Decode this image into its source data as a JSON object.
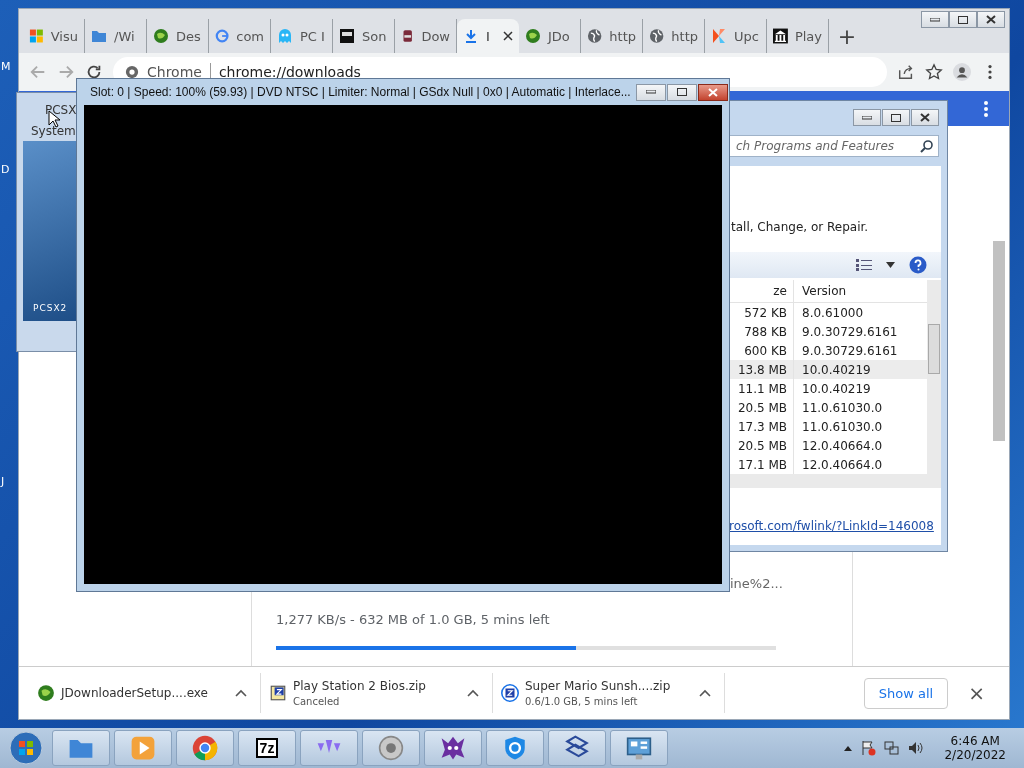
{
  "desktop": {
    "labels": [
      "M",
      "D",
      "J"
    ]
  },
  "browser": {
    "tabs": [
      {
        "label": "Visu",
        "selected": false
      },
      {
        "label": "/Wi",
        "selected": false
      },
      {
        "label": "Des",
        "selected": false
      },
      {
        "label": "com",
        "selected": false
      },
      {
        "label": "PC I",
        "selected": false
      },
      {
        "label": "Son",
        "selected": false
      },
      {
        "label": "Dow",
        "selected": false
      },
      {
        "label": "I",
        "selected": true
      },
      {
        "label": "JDo",
        "selected": false
      },
      {
        "label": "http",
        "selected": false
      },
      {
        "label": "http",
        "selected": false
      },
      {
        "label": "Upc",
        "selected": false
      },
      {
        "label": "Play",
        "selected": false
      }
    ],
    "new_tab": "+",
    "omnibox": {
      "site": "Chrome",
      "url": "chrome://downloads"
    },
    "page": {
      "link_fragment": "ine%2...",
      "progress_text": "1,277 KB/s - 632 MB of 1.0 GB, 5 mins left",
      "level": 0.6
    },
    "shelf": {
      "items": [
        {
          "name": "JDownloaderSetup....exe"
        },
        {
          "name": "Play Station 2 Bios.zip",
          "status": "Canceled"
        },
        {
          "name": "Super Mario Sunsh....zip",
          "status": "0.6/1.0 GB, 5 mins left"
        }
      ],
      "show_all": "Show all",
      "close": "×"
    }
  },
  "pcsx2_window": {
    "title": "PCSX",
    "menu": "System",
    "logo": "PCSX2"
  },
  "programs_window": {
    "search": {
      "placeholder": "ch Programs and Features"
    },
    "instruction": "tall, Change, or Repair.",
    "columns": [
      "ze",
      "Version"
    ],
    "rows": [
      {
        "size": "572 KB",
        "version": "8.0.61000",
        "selected": false
      },
      {
        "size": "788 KB",
        "version": "9.0.30729.6161",
        "selected": false
      },
      {
        "size": "600 KB",
        "version": "9.0.30729.6161",
        "selected": false
      },
      {
        "size": "13.8 MB",
        "version": "10.0.40219",
        "selected": true
      },
      {
        "size": "11.1 MB",
        "version": "10.0.40219",
        "selected": false
      },
      {
        "size": "20.5 MB",
        "version": "11.0.61030.0",
        "selected": false
      },
      {
        "size": "17.3 MB",
        "version": "11.0.61030.0",
        "selected": false
      },
      {
        "size": "20.5 MB",
        "version": "12.0.40664.0",
        "selected": false
      },
      {
        "size": "17.1 MB",
        "version": "12.0.40664.0",
        "selected": false
      }
    ],
    "link": "rosoft.com/fwlink/?LinkId=146008"
  },
  "gs_window": {
    "title": "Slot: 0 | Speed: 100% (59.93) | DVD NTSC | Limiter: Normal | GSdx Null | 0x0 | Automatic | Interlace..."
  },
  "taskbar": {
    "archiver_label": "7z",
    "time": "6:46 AM",
    "date": "2/20/2022"
  }
}
